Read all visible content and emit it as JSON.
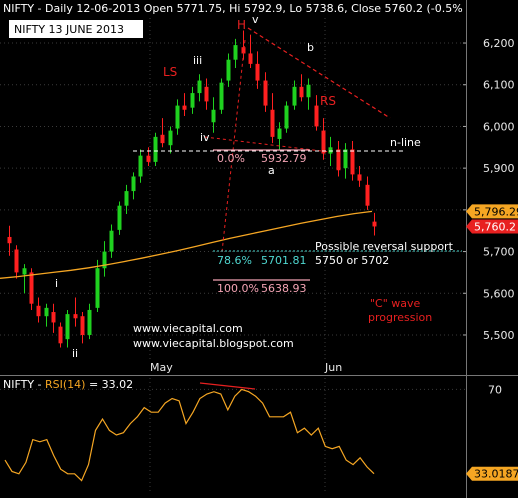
{
  "header": {
    "symbol": "NIFTY",
    "period": "Daily",
    "date": "12-06-2013",
    "ohlc_text": "NIFTY - Daily 12-06-2013 Open 5771.75, Hi 5792.9, Lo 5738.6, Close 5760.2 (-0.5%"
  },
  "title_box": "NIFTY 13 JUNE  2013",
  "website_1": "www.viecapital.com",
  "website_2": "www.viecapital.blogspot.com",
  "rsi_header": "NIFTY - RSI(14) = 33.02",
  "rsi_header_parts": {
    "a": "NIFTY - ",
    "b": "RSI(14)",
    "c": " = 33.02"
  },
  "chart_data": [
    {
      "type": "candlestick",
      "title": "NIFTY - Daily 12-06-2013",
      "ylim": [
        5440,
        6260
      ],
      "y_ticks": [
        "6,200",
        "6,100",
        "6,000",
        "5,900",
        "5,800",
        "5,700",
        "5,600",
        "5,500"
      ],
      "y_tick_values": [
        6200,
        6100,
        6000,
        5900,
        5800,
        5700,
        5600,
        5500
      ],
      "x_labels": [
        "May",
        "Jun"
      ],
      "price_badges": [
        {
          "label": "5,796.29",
          "value": 5796.29,
          "color": "#f5a623"
        },
        {
          "label": "5,760.2",
          "value": 5760.2,
          "color": "#e82020"
        }
      ],
      "candles": [
        [
          5735,
          5762,
          5690,
          5720
        ],
        [
          5705,
          5715,
          5635,
          5650
        ],
        [
          5645,
          5670,
          5600,
          5660
        ],
        [
          5650,
          5660,
          5560,
          5575
        ],
        [
          5570,
          5590,
          5530,
          5545
        ],
        [
          5545,
          5575,
          5520,
          5565
        ],
        [
          5555,
          5575,
          5505,
          5530
        ],
        [
          5520,
          5530,
          5470,
          5480
        ],
        [
          5490,
          5560,
          5470,
          5550
        ],
        [
          5550,
          5590,
          5520,
          5540
        ],
        [
          5545,
          5555,
          5480,
          5500
        ],
        [
          5500,
          5575,
          5490,
          5560
        ],
        [
          5565,
          5680,
          5555,
          5660
        ],
        [
          5660,
          5725,
          5640,
          5700
        ],
        [
          5700,
          5765,
          5685,
          5750
        ],
        [
          5752,
          5820,
          5740,
          5810
        ],
        [
          5810,
          5860,
          5790,
          5845
        ],
        [
          5845,
          5890,
          5825,
          5880
        ],
        [
          5880,
          5945,
          5865,
          5930
        ],
        [
          5930,
          5950,
          5905,
          5915
        ],
        [
          5915,
          5985,
          5905,
          5975
        ],
        [
          5980,
          6020,
          5950,
          5960
        ],
        [
          5955,
          6000,
          5935,
          5990
        ],
        [
          5995,
          6065,
          5980,
          6050
        ],
        [
          6050,
          6080,
          6025,
          6040
        ],
        [
          6045,
          6095,
          6030,
          6080
        ],
        [
          6080,
          6125,
          6060,
          6110
        ],
        [
          6095,
          6115,
          6040,
          6060
        ],
        [
          6010,
          6070,
          5985,
          6040
        ],
        [
          6040,
          6115,
          6030,
          6105
        ],
        [
          6110,
          6175,
          6095,
          6160
        ],
        [
          6160,
          6210,
          6140,
          6195
        ],
        [
          6190,
          6230,
          6160,
          6175
        ],
        [
          6175,
          6220,
          6140,
          6150
        ],
        [
          6150,
          6180,
          6090,
          6110
        ],
        [
          6110,
          6130,
          6035,
          6050
        ],
        [
          6040,
          6080,
          5960,
          5975
        ],
        [
          5970,
          6010,
          5945,
          5995
        ],
        [
          5995,
          6060,
          5985,
          6050
        ],
        [
          6050,
          6110,
          6040,
          6095
        ],
        [
          6095,
          6125,
          6060,
          6070
        ],
        [
          6070,
          6115,
          6040,
          6100
        ],
        [
          6050,
          6075,
          5990,
          6000
        ],
        [
          5990,
          6020,
          5920,
          5935
        ],
        [
          5935,
          5975,
          5905,
          5950
        ],
        [
          5945,
          5965,
          5880,
          5895
        ],
        [
          5900,
          5960,
          5875,
          5945
        ],
        [
          5945,
          5965,
          5870,
          5885
        ],
        [
          5885,
          5905,
          5855,
          5870
        ],
        [
          5860,
          5880,
          5800,
          5810
        ],
        [
          5771.75,
          5792.9,
          5738.6,
          5760.2
        ]
      ],
      "ma_200": [
        5636,
        5640,
        5645,
        5650,
        5655,
        5661,
        5668,
        5676,
        5684,
        5693,
        5702,
        5712,
        5722,
        5732,
        5741,
        5750,
        5759,
        5768,
        5776,
        5784,
        5791,
        5796.29
      ],
      "annotations": {
        "LS": "LS",
        "H": "H",
        "RS": "RS",
        "v": "v",
        "iii": "iii",
        "iv": "iv",
        "i": "i",
        "ii": "ii",
        "a": "a",
        "b": "b",
        "n_line": "n-line",
        "fib_0": "0.0%",
        "fib_0_val": "5932.79",
        "fib_786": "78.6%",
        "fib_786_val": "5701.81",
        "fib_100": "100.0%",
        "fib_100_val": "5638.93",
        "reversal_1": "Possible reversal support",
        "reversal_2": "5750 or 5702",
        "c_wave_1": "\"C\" wave",
        "c_wave_2": "progression"
      }
    },
    {
      "type": "line",
      "title": "NIFTY - RSI(14) = 33.02",
      "ylim": [
        25,
        75
      ],
      "y_ticks": [
        "70"
      ],
      "y_tick_values": [
        70
      ],
      "last_value_label": "33.0187",
      "last_value": 33.0187,
      "values": [
        39,
        34,
        33,
        38,
        48,
        47,
        48,
        41,
        35,
        33,
        33,
        30,
        37,
        52,
        57,
        52,
        50,
        51,
        55,
        58,
        62,
        60,
        60,
        64,
        66,
        65,
        55,
        60,
        66,
        68,
        69,
        68,
        61,
        67,
        70,
        69,
        67,
        64,
        58,
        58,
        58,
        60,
        51,
        53,
        50,
        53,
        45,
        44,
        45,
        39,
        37,
        40,
        36,
        33.02
      ]
    }
  ],
  "colors": {
    "bull": "#1fd11f",
    "bear": "#ff2020",
    "ma": "#f5a623",
    "annot_red": "#e82020",
    "fib_pink": "#f4a4b4",
    "fib_cyan": "#4fd7d0",
    "axis_text": "#e8e8e8",
    "grid": "#3a3a3a"
  }
}
